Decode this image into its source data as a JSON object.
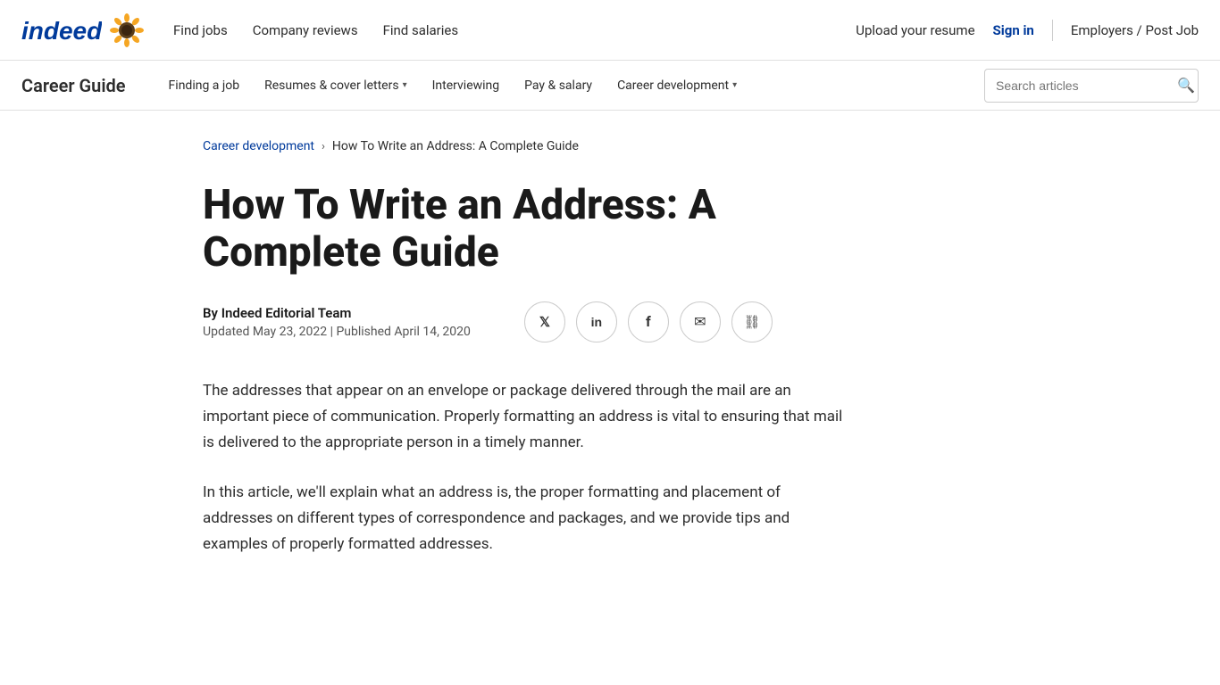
{
  "topNav": {
    "logoText": "indeed",
    "links": [
      {
        "label": "Find jobs",
        "href": "#"
      },
      {
        "label": "Company reviews",
        "href": "#"
      },
      {
        "label": "Find salaries",
        "href": "#"
      }
    ],
    "rightLinks": [
      {
        "label": "Upload your resume",
        "href": "#"
      },
      {
        "label": "Sign in",
        "href": "#",
        "highlight": true
      },
      {
        "label": "Employers / Post Job",
        "href": "#"
      }
    ]
  },
  "secondNav": {
    "title": "Career Guide",
    "links": [
      {
        "label": "Finding a job",
        "hasDropdown": false
      },
      {
        "label": "Resumes & cover letters",
        "hasDropdown": true
      },
      {
        "label": "Interviewing",
        "hasDropdown": false
      },
      {
        "label": "Pay & salary",
        "hasDropdown": false
      },
      {
        "label": "Career development",
        "hasDropdown": true
      }
    ],
    "search": {
      "placeholder": "Search articles"
    }
  },
  "breadcrumb": {
    "parent": "Career development",
    "current": "How To Write an Address: A Complete Guide"
  },
  "article": {
    "title": "How To Write an Address: A Complete Guide",
    "author": "By Indeed Editorial Team",
    "date": "Updated May 23, 2022 | Published April 14, 2020",
    "body": [
      "The addresses that appear on an envelope or package delivered through the mail are an important piece of communication. Properly formatting an address is vital to ensuring that mail is delivered to the appropriate person in a timely manner.",
      "In this article, we'll explain what an address is, the proper formatting and placement of addresses on different types of correspondence and packages, and we provide tips and examples of properly formatted addresses."
    ]
  },
  "socialIcons": [
    {
      "name": "twitter",
      "symbol": "𝕏"
    },
    {
      "name": "linkedin",
      "symbol": "in"
    },
    {
      "name": "facebook",
      "symbol": "f"
    },
    {
      "name": "email",
      "symbol": "✉"
    },
    {
      "name": "link",
      "symbol": "🔗"
    }
  ],
  "colors": {
    "indeedBlue": "#003a9b",
    "accent": "#003a9b"
  }
}
